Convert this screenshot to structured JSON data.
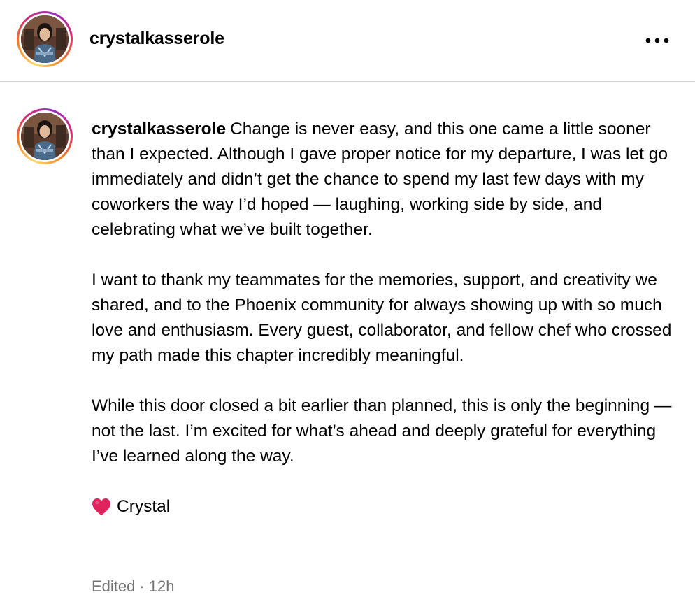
{
  "header": {
    "username": "crystalkasserole",
    "more_icon": "more-horizontal-icon"
  },
  "comment": {
    "username": "crystalkasserole",
    "paragraphs": [
      "Change is never easy, and this one came a little sooner than I expected. Although I gave proper notice for my departure, I was let go immediately and didn’t get the chance to spend my last few days with my coworkers the way I’d hoped — laughing, working side by side, and celebrating what we’ve built together.",
      "I want to thank my teammates for the memories, support, and creativity we shared, and to the Phoenix community for always showing up with so much love and enthusiasm. Every guest, collaborator, and fellow chef who crossed my path made this chapter incredibly meaningful.",
      "While this door closed a bit earlier than planned, this is only the beginning — not the last. I’m excited for what’s ahead and deeply grateful for everything I’ve learned along the way."
    ],
    "signature_name": "Crystal",
    "signature_icon": "red-heart-icon",
    "edited_label": "Edited",
    "separator": "·",
    "time": "12h"
  },
  "colors": {
    "text": "#000000",
    "meta": "#737373",
    "divider": "#dbdbdb",
    "heart": "#e0245e"
  }
}
